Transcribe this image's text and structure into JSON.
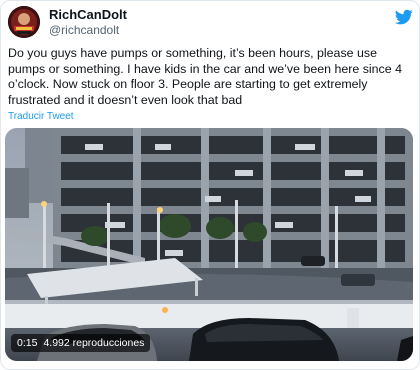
{
  "tweet": {
    "display_name": "RichCanDolt",
    "handle": "@richcandolt",
    "text": "Do you guys have pumps or something, it’s been hours, please use pumps or something. I have kids in the car and we’ve been here since 4 o’clock. Now stuck on floor 3. People are starting to get extremely frustrated and it doesn’t even look that bad",
    "translate_label": "Traducir Tweet"
  },
  "video": {
    "duration": "0:15",
    "views": "4.992 reproducciones"
  },
  "icons": {
    "brand": "twitter-bird-icon",
    "avatar": "profile-avatar"
  },
  "colors": {
    "link": "#1d9bf0",
    "brand": "#1d9bf0",
    "text": "#0f1419",
    "secondary": "#536471"
  }
}
